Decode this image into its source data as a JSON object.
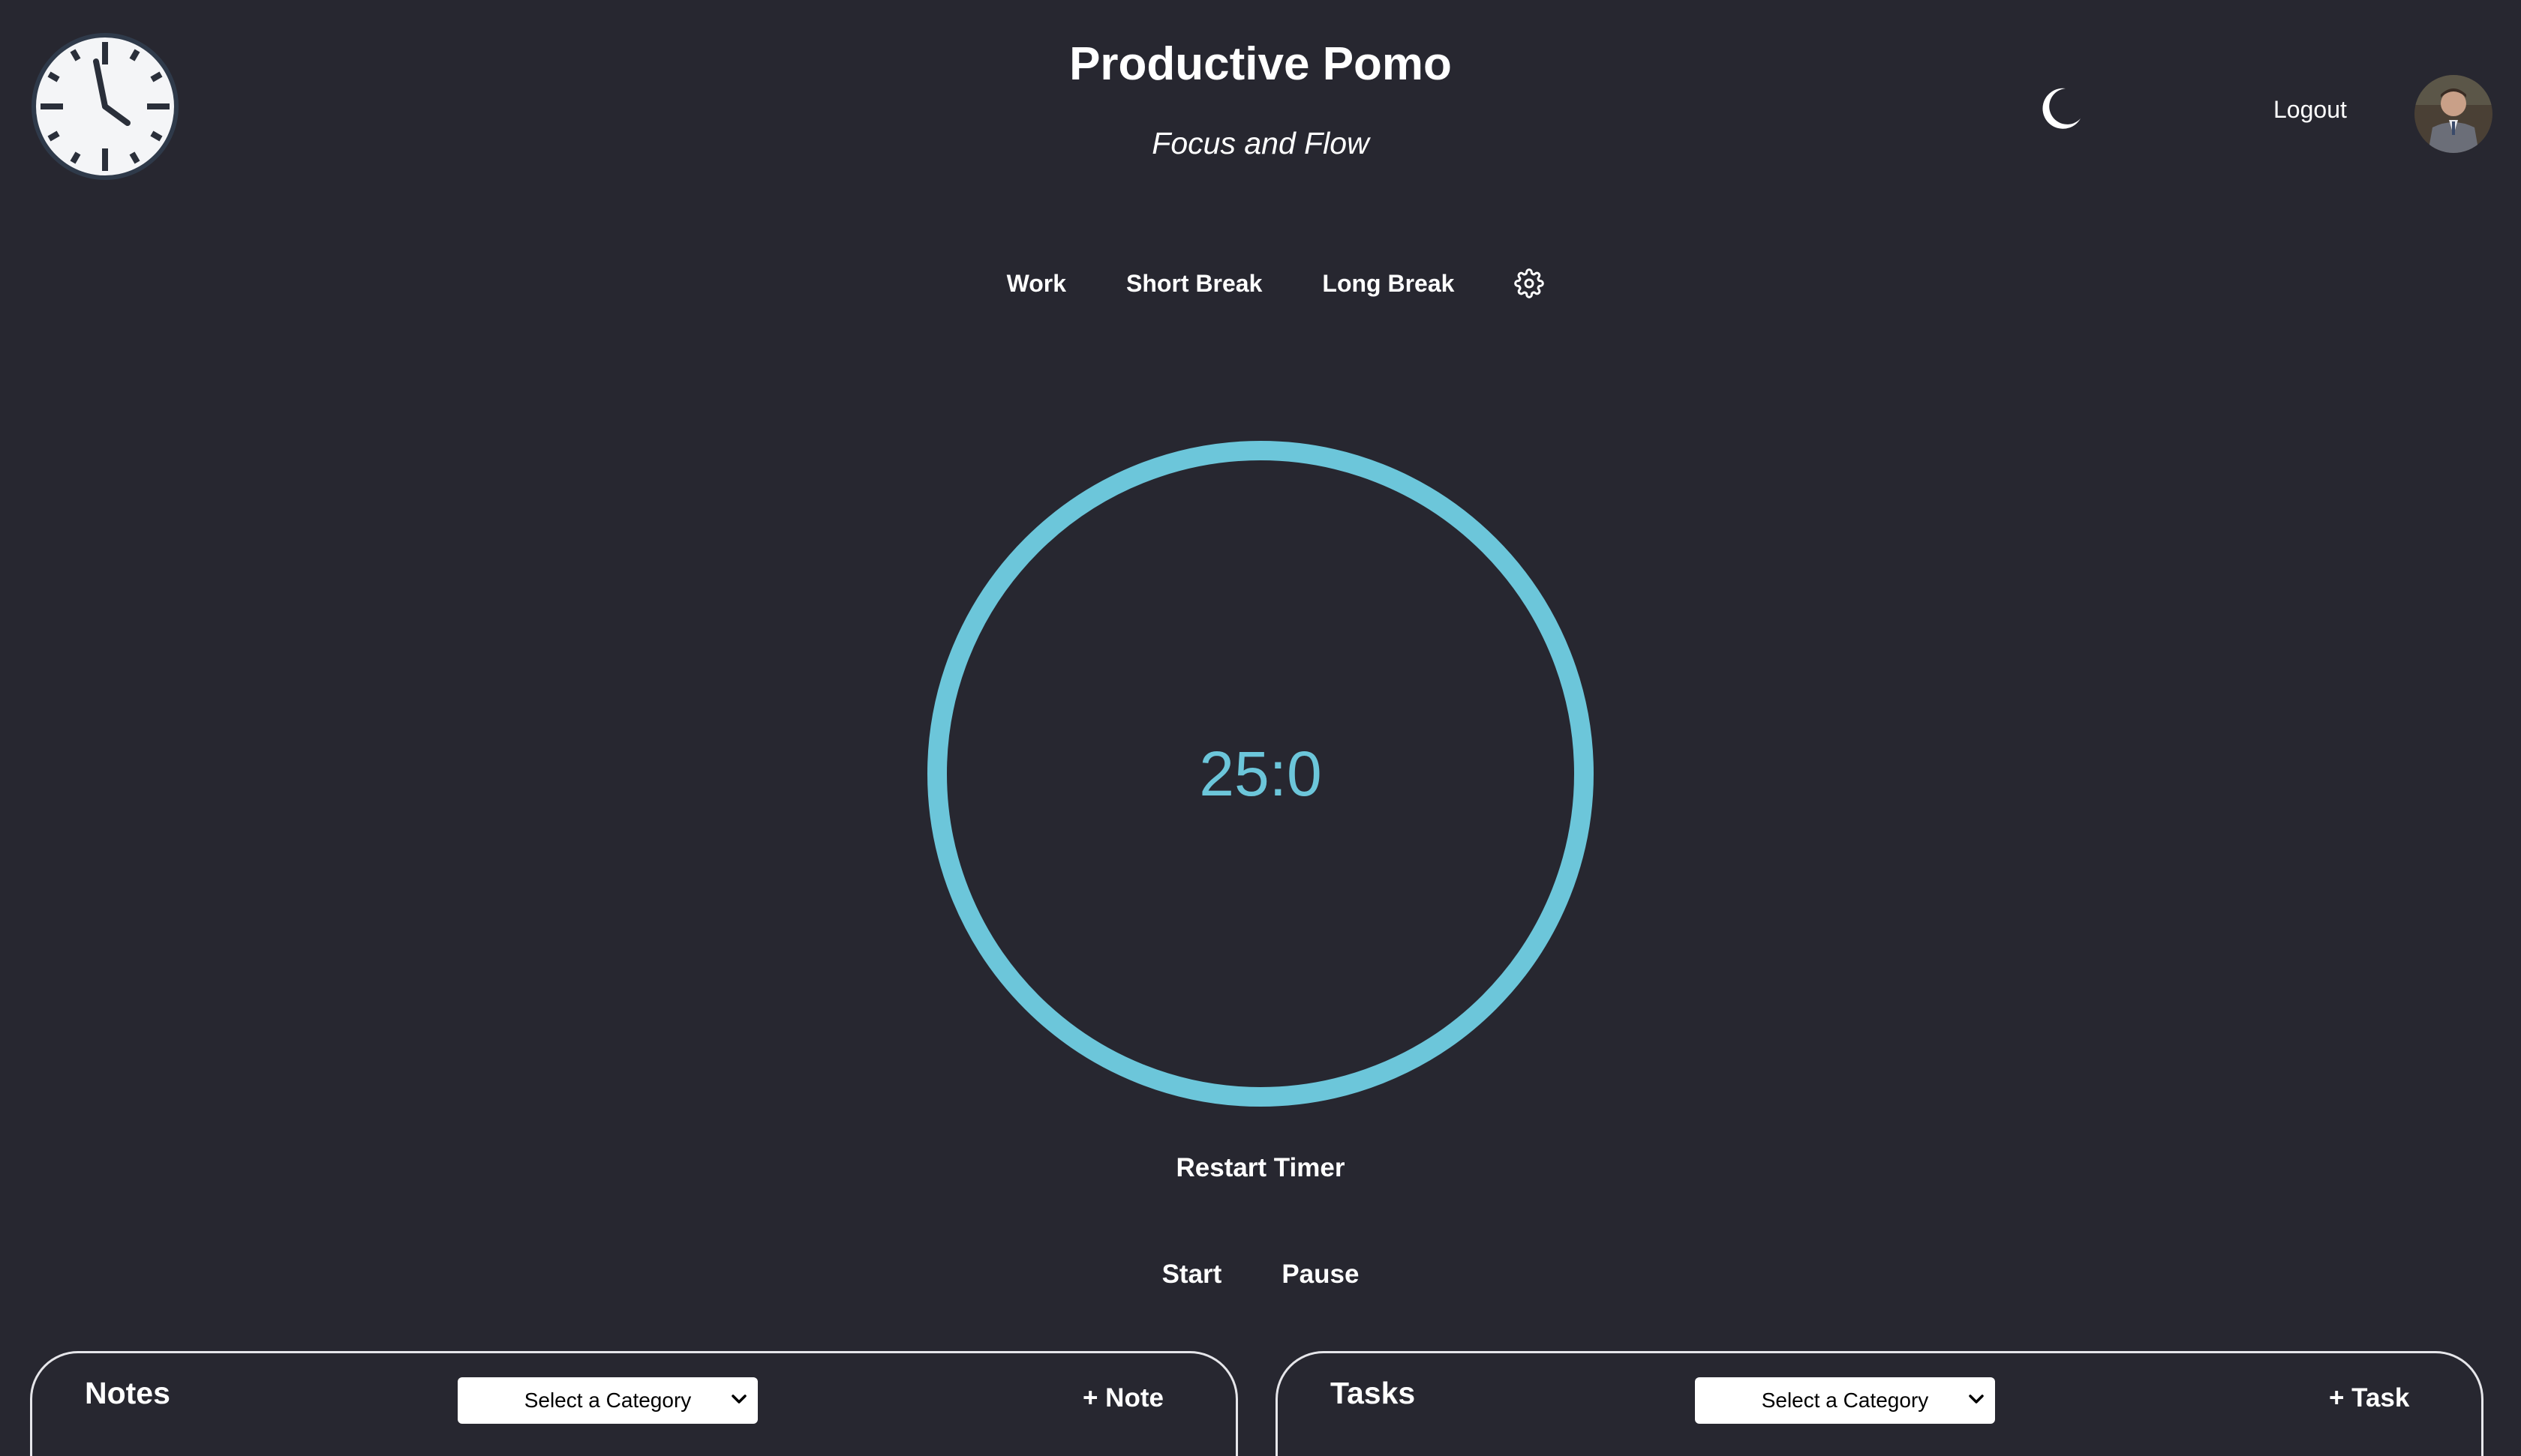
{
  "header": {
    "title": "Productive Pomo",
    "subtitle": "Focus and Flow",
    "logo_icon": "clock-icon",
    "theme_toggle_icon": "moon-icon",
    "logout_label": "Logout",
    "avatar_icon": "user-avatar"
  },
  "modes": {
    "items": [
      "Work",
      "Short Break",
      "Long Break"
    ],
    "settings_icon": "gear-icon"
  },
  "timer": {
    "display": "25:0",
    "ring_color": "#6cc6da",
    "progress": 1.0
  },
  "controls": {
    "restart_label": "Restart Timer",
    "start_label": "Start",
    "pause_label": "Pause"
  },
  "notes_panel": {
    "title": "Notes",
    "category_value": "Select a Category",
    "add_label": "+ Note"
  },
  "tasks_panel": {
    "title": "Tasks",
    "category_value": "Select a Category",
    "add_label": "+ Task"
  },
  "colors": {
    "background": "#272730",
    "accent": "#6cc6da",
    "text": "#ffffff"
  }
}
